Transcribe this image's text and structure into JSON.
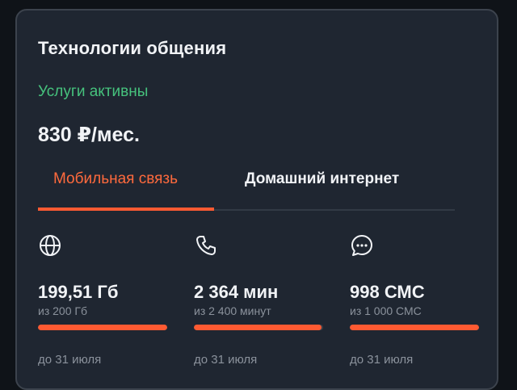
{
  "card": {
    "title": "Технологии общения",
    "status": "Услуги активны",
    "price": "830 ₽/мес."
  },
  "tabs": [
    {
      "label": "Мобильная связь",
      "active": true
    },
    {
      "label": "Домашний интернет",
      "active": false
    }
  ],
  "usage": [
    {
      "icon": "globe-icon",
      "amount": "199,51 Гб",
      "limit": "из 200 Гб",
      "fraction": 0.9976,
      "expiry": "до 31 июля"
    },
    {
      "icon": "phone-icon",
      "amount": "2 364 мин",
      "limit": "из 2 400 минут",
      "fraction": 0.985,
      "expiry": "до 31 июля"
    },
    {
      "icon": "chat-bubble-icon",
      "amount": "998 СМС",
      "limit": "из 1 000 СМС",
      "fraction": 0.998,
      "expiry": "до 31 июля"
    }
  ],
  "colors": {
    "accent": "#ff5a32",
    "status_green": "#46c27d",
    "card_background": "#1f2631",
    "page_background": "#0f1318"
  }
}
